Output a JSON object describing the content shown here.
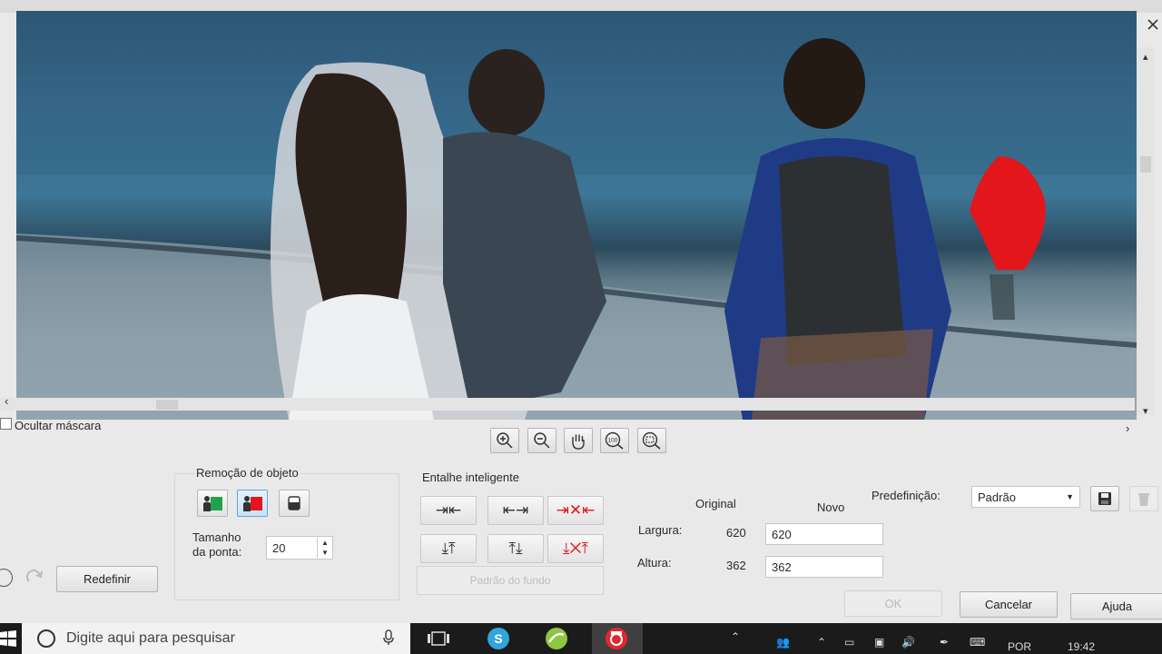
{
  "window": {
    "maximize_icon": "maximize-icon",
    "close_icon": "close-icon"
  },
  "preview": {
    "mask_color": "#e3161c"
  },
  "mask": {
    "hide_label": "Ocultar máscara"
  },
  "zoom_tools": [
    "zoom-in-icon",
    "zoom-out-icon",
    "pan-hand-icon",
    "zoom-100-icon",
    "zoom-fit-icon"
  ],
  "object_removal": {
    "title": "Remoção de objeto",
    "brush_size_label_1": "Tamanho",
    "brush_size_label_2": "da ponta:",
    "brush_size_value": "20"
  },
  "smart_carve": {
    "title": "Entalhe inteligente",
    "remove_bg_label": "Padrão do fundo"
  },
  "size": {
    "original_header": "Original",
    "new_header": "Novo",
    "width_label": "Largura:",
    "width_original": "620",
    "width_new": "620",
    "height_label": "Altura:",
    "height_original": "362",
    "height_new": "362"
  },
  "preset": {
    "label": "Predefinição:",
    "value": "Padrão"
  },
  "actions": {
    "reset": "Redefinir",
    "ok": "OK",
    "cancel": "Cancelar",
    "help": "Ajuda"
  },
  "taskbar": {
    "search_placeholder": "Digite aqui para pesquisar",
    "language": "POR",
    "time": "19:42"
  }
}
